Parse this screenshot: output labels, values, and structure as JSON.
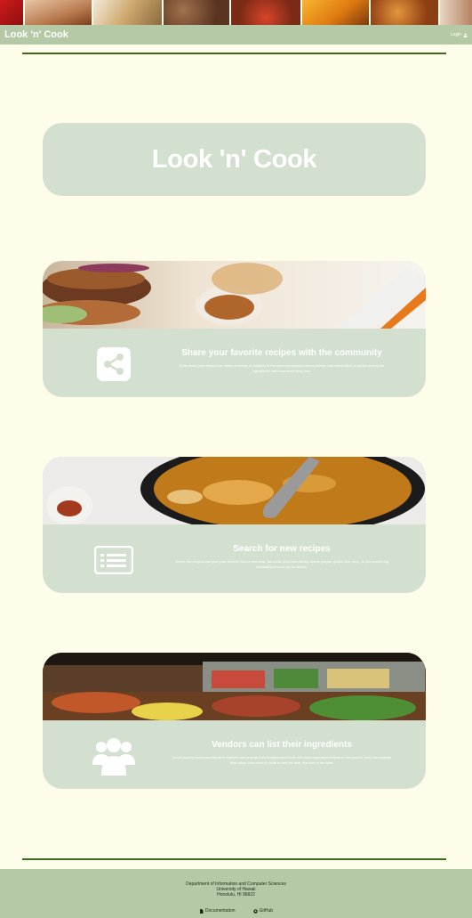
{
  "app": {
    "brand": "Look 'n' Cook",
    "login_label": "Login"
  },
  "colors": {
    "navbar": "#b5c9a7",
    "card": "#d4e0cf",
    "rule": "#3d6b1e",
    "background": "#fdfde9"
  },
  "hero": {
    "title": "Look 'n' Cook"
  },
  "features": [
    {
      "heading": "Share your favorite recipes with the community",
      "description": "Write down your recipes for others to follow. In addition to the usual preparation and a picture, add information on where to buy the ingredients, and how much they cost.",
      "icon": "share-icon"
    },
    {
      "heading": "Search for new recipes",
      "description": "Search for recipes that give your favorite food a new twist, fall under your own dietary needs (vegan, gluten-free, etc.), or just something interesting to cook up for dinner!",
      "icon": "list-card-icon"
    },
    {
      "heading": "Vendors can list their ingredients",
      "description": "Local grocery stores and farmer's markets can provide their location and hours, the each ingredient defined in the system, they can indicate their stock, how much it costs to buy the item, the size of the item.",
      "icon": "users-icon"
    }
  ],
  "footer": {
    "lines": [
      "Department of Information and Computer Sciences",
      "University of Hawaii",
      "Honolulu, HI 96822"
    ],
    "documentation_label": "Documentation",
    "github_label": "GitHub"
  }
}
